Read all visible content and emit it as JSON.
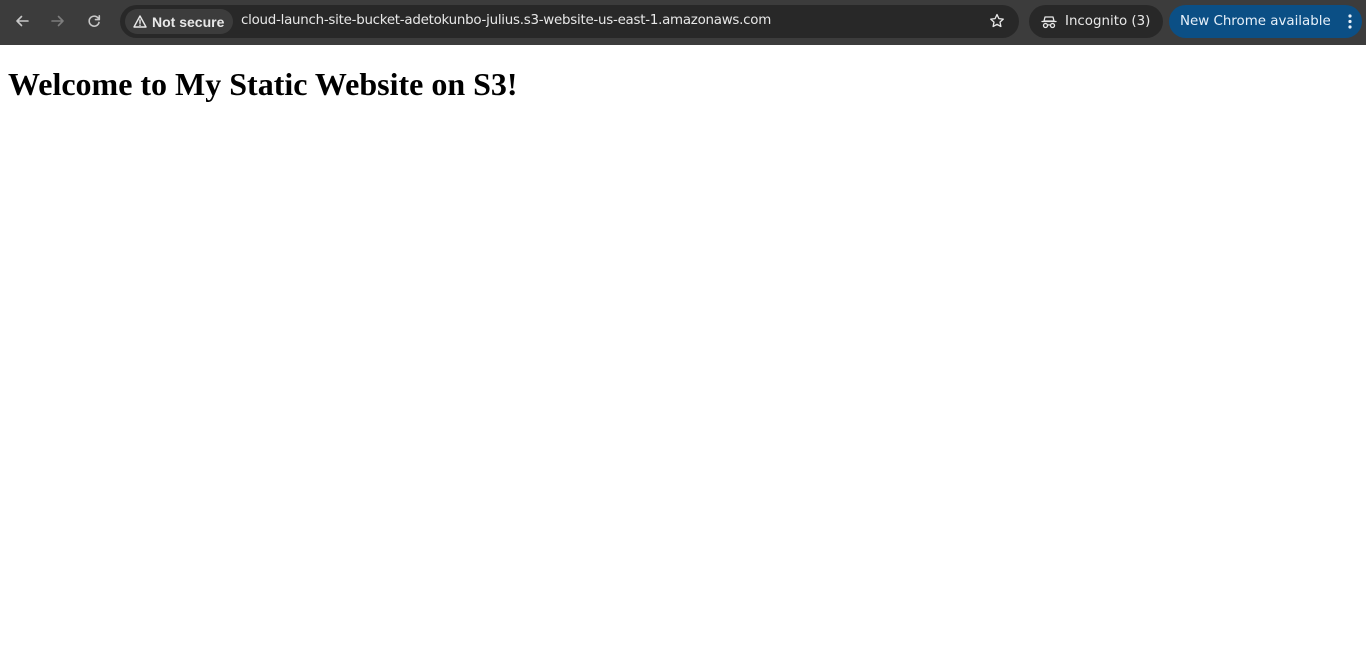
{
  "browser": {
    "security_label": "Not secure",
    "url": "cloud-launch-site-bucket-adetokunbo-julius.s3-website-us-east-1.amazonaws.com",
    "incognito_label": "Incognito (3)",
    "update_label": "New Chrome available",
    "icons": {
      "back": "arrow-left-icon",
      "forward": "arrow-right-icon",
      "reload": "reload-icon",
      "warning": "warning-triangle-icon",
      "bookmark": "star-icon",
      "incognito": "incognito-icon",
      "menu": "kebab-menu-icon"
    },
    "colors": {
      "toolbar": "#3c3c3c",
      "omnibox": "#282828",
      "update_button": "#0b4f85"
    }
  },
  "page": {
    "heading": "Welcome to My Static Website on S3!"
  }
}
